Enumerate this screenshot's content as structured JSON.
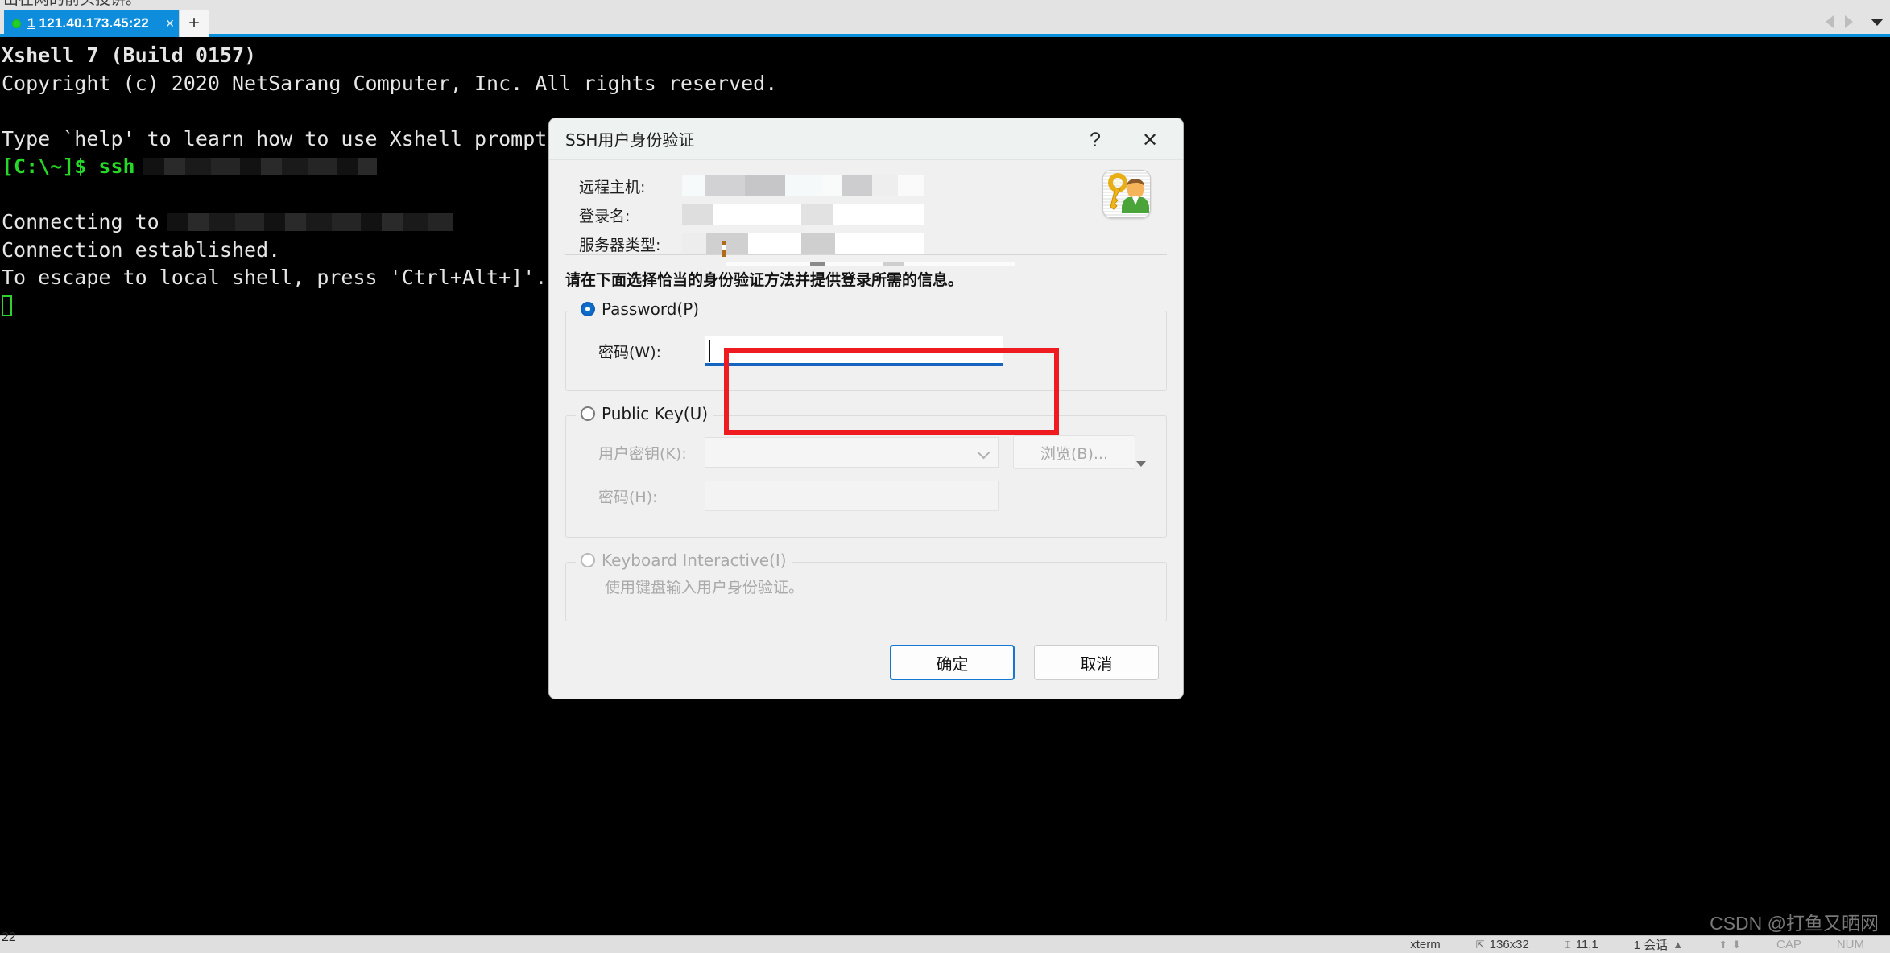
{
  "window": {
    "clipped_text_above": "出在网的前头投讲。"
  },
  "tabbar": {
    "tab_index": "1",
    "tab_title": "121.40.173.45:22",
    "close_label": "×",
    "new_tab_label": "+",
    "nav": {
      "prev_icon": "chevron-left-icon",
      "next_icon": "chevron-right-icon",
      "list_icon": "chevron-down-icon"
    }
  },
  "terminal": {
    "lines": [
      {
        "text": "Xshell 7 (Build 0157)",
        "bold": true
      },
      {
        "text": "Copyright (c) 2020 NetSarang Computer, Inc. All rights reserved.",
        "bold": false
      },
      {
        "text": "",
        "bold": false
      },
      {
        "text": "Type `help' to learn how to use Xshell prompt.",
        "bold": false
      },
      {
        "text": "[C:\\~]$ ssh",
        "bold": false,
        "prompt": true,
        "redacted_after": true
      },
      {
        "text": "",
        "bold": false
      },
      {
        "text": "Connecting to",
        "bold": false,
        "redacted_after": true
      },
      {
        "text": "Connection established.",
        "bold": false
      },
      {
        "text": "To escape to local shell, press 'Ctrl+Alt+]'.",
        "bold": false
      }
    ],
    "cursor": "block-cursor"
  },
  "dialog": {
    "title": "SSH用户身份验证",
    "help_label": "?",
    "close_label": "✕",
    "host_info": {
      "rows": [
        {
          "label": "远程主机:",
          "value": ""
        },
        {
          "label": "登录名:",
          "value": ""
        },
        {
          "label": "服务器类型:",
          "value": ""
        }
      ],
      "icon": "key-user-icon"
    },
    "hint": "请在下面选择恰当的身份验证方法并提供登录所需的信息。",
    "password_group": {
      "legend": "Password(P)",
      "selected": true,
      "password_label": "密码(W):",
      "password_value": ""
    },
    "publickey_group": {
      "legend": "Public Key(U)",
      "selected": false,
      "userkey_label": "用户密钥(K):",
      "userkey_value": "",
      "passphrase_label": "密码(H):",
      "passphrase_value": "",
      "browse_label": "浏览(B)..."
    },
    "keyboard_group": {
      "legend": "Keyboard Interactive(I)",
      "selected": false,
      "description": "使用键盘输入用户身份验证。"
    },
    "buttons": {
      "ok": "确定",
      "cancel": "取消"
    },
    "annotation": {
      "color": "#ee1c20",
      "shape": "rectangle"
    }
  },
  "statusbar": {
    "left_text": "22",
    "terminal_type": "xterm",
    "size_icon": "resize-icon",
    "size": "136x32",
    "cursor_icon": "cursor-icon",
    "cursor_pos": "11,1",
    "sessions": "1 会话",
    "session_caret": "▲",
    "upload_icon": "⬆",
    "download_icon": "⬇",
    "caps": "CAP",
    "num": "NUM"
  },
  "watermark": "CSDN @打鱼又晒网"
}
